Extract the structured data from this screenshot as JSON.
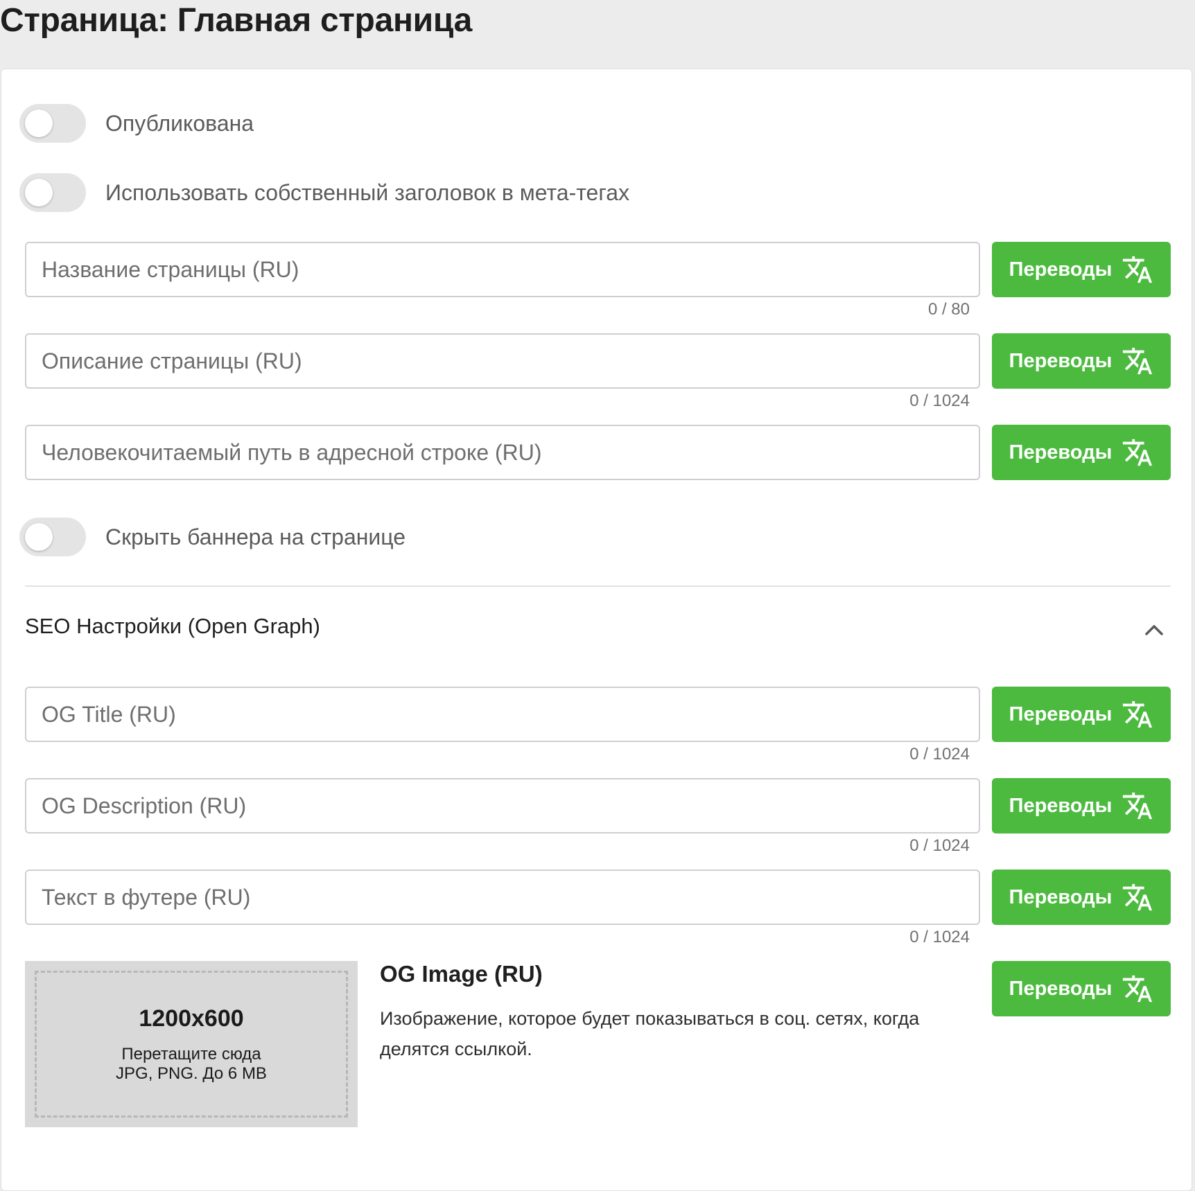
{
  "page": {
    "title": "Страница: Главная страница"
  },
  "toggles": {
    "published": {
      "label": "Опубликована",
      "on": false
    },
    "custom_meta_title": {
      "label": "Использовать собственный заголовок в мета-тегах",
      "on": false
    },
    "hide_banners": {
      "label": "Скрыть баннера на странице",
      "on": false
    }
  },
  "fields": {
    "page_name": {
      "placeholder": "Название страницы (RU)",
      "value": "",
      "counter": "0 / 80"
    },
    "page_description": {
      "placeholder": "Описание страницы (RU)",
      "value": "",
      "counter": "0 / 1024"
    },
    "page_slug": {
      "placeholder": "Человекочитаемый путь в адресной строке (RU)",
      "value": ""
    },
    "og_title": {
      "placeholder": "OG Title (RU)",
      "value": "",
      "counter": "0 / 1024"
    },
    "og_description": {
      "placeholder": "OG Description (RU)",
      "value": "",
      "counter": "0 / 1024"
    },
    "footer_text": {
      "placeholder": "Текст в футере (RU)",
      "value": "",
      "counter": "0 / 1024"
    }
  },
  "translations_button": {
    "label": "Переводы",
    "icon": "translate-icon",
    "color": "#4cba3f"
  },
  "seo_section": {
    "title": "SEO Настройки (Open Graph)",
    "expanded": true,
    "collapse_icon": "chevron-up-icon"
  },
  "og_image": {
    "size": "1200x600",
    "drop_hint": "Перетащите сюда",
    "formats": "JPG, PNG. До 6 MB",
    "title": "OG Image (RU)",
    "description": "Изображение, которое будет показываться в соц. сетях, когда делятся ссылкой."
  }
}
